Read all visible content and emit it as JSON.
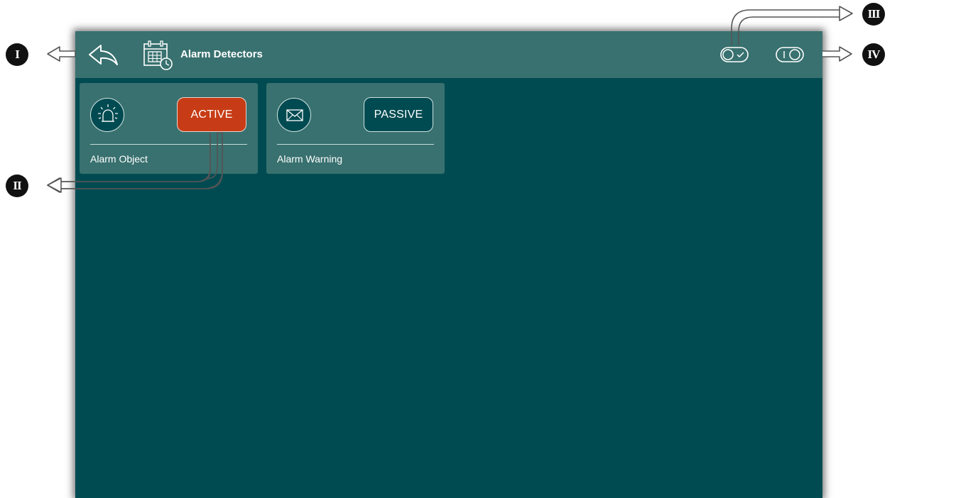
{
  "header": {
    "title": "Alarm Detectors",
    "back_icon": "back-arrow-icon",
    "app_icon": "calendar-clock-icon",
    "toggle_confirm_icon": "toggle-check-icon",
    "toggle_power_icon": "toggle-power-icon"
  },
  "cards": [
    {
      "icon": "siren-icon",
      "state_label": "ACTIVE",
      "label": "Alarm Object"
    },
    {
      "icon": "envelope-icon",
      "state_label": "PASSIVE",
      "label": "Alarm Warning"
    }
  ],
  "callouts": [
    "I",
    "II",
    "III",
    "IV"
  ],
  "colors": {
    "background": "#004b52",
    "topbar": "#38716f",
    "card": "#38716f",
    "active": "#c73c16",
    "passive": "#004b52",
    "text": "#ffffff"
  }
}
